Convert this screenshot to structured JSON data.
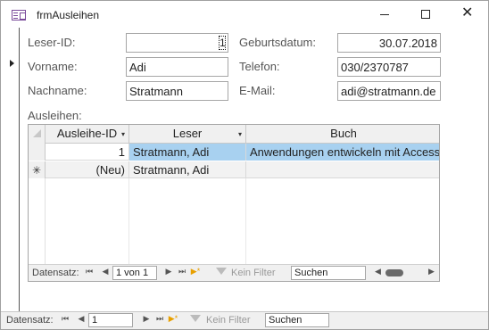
{
  "window": {
    "title": "frmAusleihen",
    "minimize_icon": "minimize-icon",
    "maximize_icon": "maximize-icon",
    "close_glyph": "✕"
  },
  "form": {
    "leser_id": {
      "label": "Leser-ID:",
      "value": "1"
    },
    "vorname": {
      "label": "Vorname:",
      "value": "Adi"
    },
    "nachname": {
      "label": "Nachname:",
      "value": "Stratmann"
    },
    "geburtsdatum": {
      "label": "Geburtsdatum:",
      "value": "30.07.2018"
    },
    "telefon": {
      "label": "Telefon:",
      "value": "030/2370787"
    },
    "email": {
      "label": "E-Mail:",
      "value": "adi@stratmann.de"
    }
  },
  "subform": {
    "label": "Ausleihen:",
    "columns": [
      {
        "title": "Ausleihe-ID",
        "dropdown": "▾"
      },
      {
        "title": "Leser",
        "dropdown": "▾"
      },
      {
        "title": "Buch",
        "dropdown": ""
      }
    ],
    "rows": [
      {
        "selector": "",
        "id": "1",
        "leser": "Stratmann, Adi",
        "buch": "Anwendungen entwickeln mit Access"
      },
      {
        "selector": "✳",
        "id": "(Neu)",
        "leser": "Stratmann, Adi",
        "buch": ""
      }
    ],
    "nav": {
      "label": "Datensatz:",
      "first": "⏮",
      "prev": "◀",
      "position": "1 von 1",
      "next": "▶",
      "last": "⏭",
      "new": "▶*",
      "filter": "Kein Filter",
      "search_placeholder": "Suchen"
    }
  },
  "main_nav": {
    "label": "Datensatz:",
    "first": "⏮",
    "prev": "◀",
    "position": "1",
    "next": "▶",
    "last": "⏭",
    "new": "▶*",
    "filter": "Kein Filter",
    "search_placeholder": "Suchen"
  },
  "colors": {
    "selected_cell": "#a8d1f0",
    "header_bg": "#f0f0f0"
  }
}
